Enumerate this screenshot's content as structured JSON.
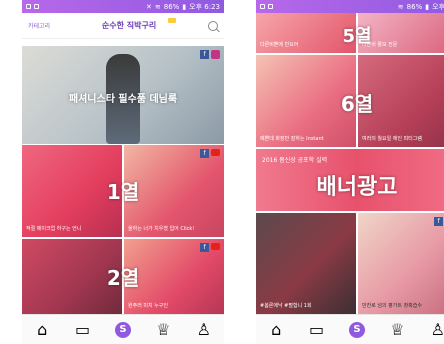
{
  "status_left": {
    "time": "오후 6:23",
    "battery": "86%"
  },
  "status_right": {
    "time": "오후 1:",
    "battery": "86%"
  },
  "left": {
    "header": {
      "category": "카테고리",
      "title": "순수한 직박구리"
    },
    "hero_caption": "패셔니스타 필수품 데님룩",
    "tiles": [
      {
        "caption": "적절 메이크업 하구는 언니"
      },
      {
        "caption": "울하는 너가 치우쳤 입어 Click!"
      },
      {
        "caption": ""
      },
      {
        "caption": "원주러 미치 누구인"
      }
    ],
    "overlay_1": "1열",
    "overlay_2": "2열"
  },
  "right": {
    "overlay_5": "5열",
    "overlay_6": "6열",
    "overlay_banner": "배너광고",
    "tiles": [
      {
        "caption": "다른비쁜에 반요어"
      },
      {
        "caption": "다른비 활보 전문"
      },
      {
        "caption": "예쁜데 화장만 잘하는 Instant"
      },
      {
        "caption": "여러의 월요일 에인 피티그램"
      },
      {
        "caption": "#봄론에낙 #펄합니 1회"
      },
      {
        "caption": "만찬로 넘의 평가트 창혹습수"
      }
    ],
    "banner_sub": "2016 봄신상 공포학 실력"
  },
  "nav_icons": [
    "home-icon",
    "folder-icon",
    "s-logo-icon",
    "trophy-icon",
    "profile-icon"
  ],
  "colors": {
    "accent": "#8f5ae0",
    "tile_pink": "#e94a6c"
  }
}
